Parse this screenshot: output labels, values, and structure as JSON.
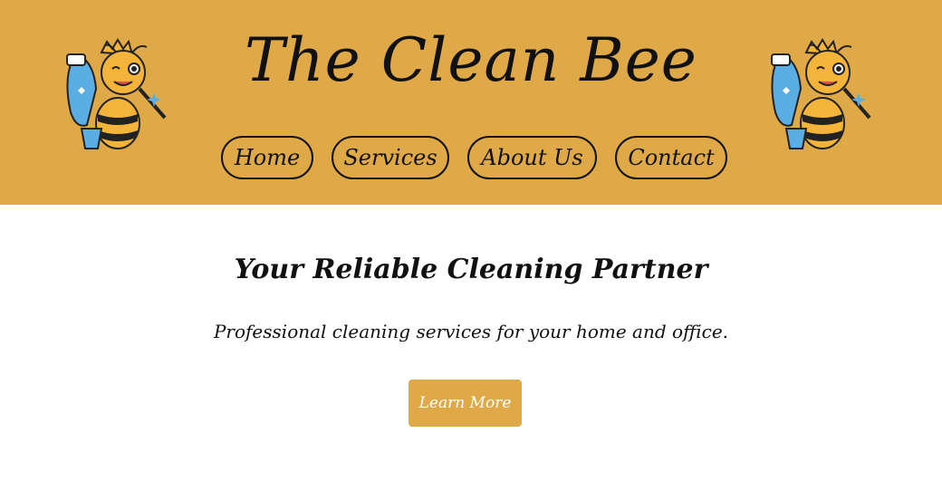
{
  "header": {
    "title": "The Clean Bee",
    "logo_icon": "bee-mascot-icon",
    "background_color": "#dfa947"
  },
  "nav": {
    "items": [
      {
        "label": "Home"
      },
      {
        "label": "Services"
      },
      {
        "label": "About Us"
      },
      {
        "label": "Contact"
      }
    ]
  },
  "hero": {
    "title": "Your Reliable Cleaning Partner",
    "subtitle": "Professional cleaning services for your home and office.",
    "cta_label": "Learn More",
    "cta_color": "#dfa947"
  }
}
